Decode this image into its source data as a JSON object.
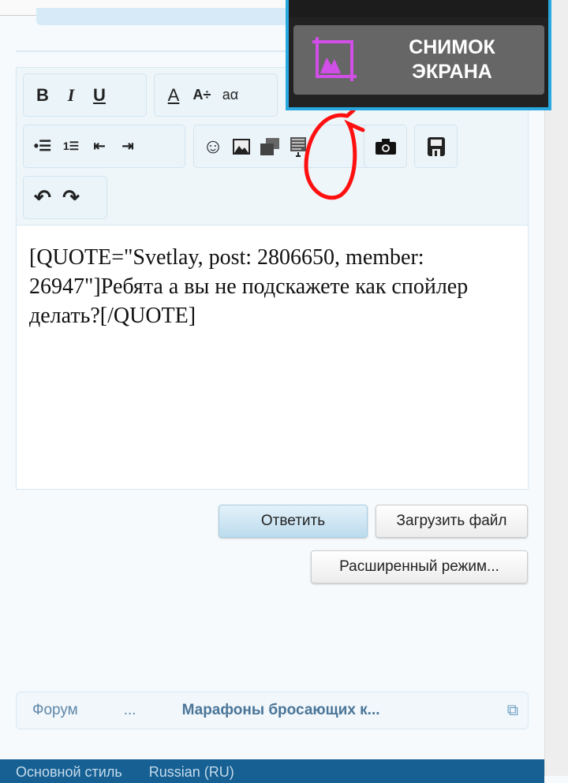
{
  "toolbar": {
    "row1": [
      "bold",
      "italic",
      "underline",
      "font-color",
      "font-size",
      "font-family"
    ],
    "row2": [
      "bullet-list",
      "numbered-list",
      "outdent",
      "indent",
      "smilies",
      "image",
      "media",
      "spoiler",
      "camera",
      "save-draft"
    ],
    "row3": [
      "undo",
      "redo"
    ],
    "bold": "B",
    "italic": "I",
    "underline": "U",
    "font_color": "A",
    "font_size": "A÷",
    "font_family": "aα"
  },
  "editor": {
    "text": "[QUOTE=\"Svetlay, post: 2806650, member: 26947\"]Ребята а вы не подскажете как спойлер  делать?[/QUOTE]"
  },
  "buttons": {
    "reply": "Ответить",
    "upload": "Загрузить файл",
    "advanced": "Расширенный режим..."
  },
  "breadcrumb": [
    "Форум",
    "...",
    "Марафоны бросающих к..."
  ],
  "footer": {
    "style": "Основной стиль",
    "language": "Russian (RU)"
  },
  "screenshot_popup": {
    "label_line1": "СНИМОК",
    "label_line2": "ЭКРАНА"
  },
  "colors": {
    "popup_border": "#29a8e0",
    "crop_icon": "#d24ee8",
    "footer": "#166093",
    "annotation": "#ff0000"
  }
}
